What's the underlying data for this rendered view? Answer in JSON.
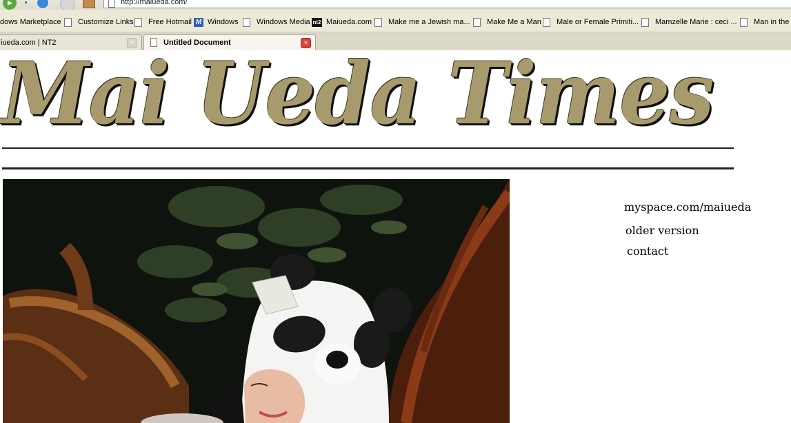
{
  "browser": {
    "address": "http://maiueda.com/",
    "nav_dropdown_glyph": "▾",
    "bookmarks": [
      {
        "label": "dows Marketplace",
        "icon": "none"
      },
      {
        "label": "Customize Links",
        "icon": "page-icon"
      },
      {
        "label": "Free Hotmail",
        "icon": "page-icon"
      },
      {
        "label": "Windows",
        "icon": "msn-m-icon"
      },
      {
        "label": "Windows Media",
        "icon": "page-icon"
      },
      {
        "label": "Maiueda.com",
        "icon": "nt2-icon"
      },
      {
        "label": "Make me a Jewish ma...",
        "icon": "page-icon"
      },
      {
        "label": "Make Me a Man",
        "icon": "page-icon"
      },
      {
        "label": "Male or Female Primiti...",
        "icon": "page-icon"
      },
      {
        "label": "Mamzelle Marie : ceci ...",
        "icon": "page-icon"
      },
      {
        "label": "Man in the I",
        "icon": "page-icon"
      }
    ],
    "tabs": [
      {
        "label": "iueda.com | NT2",
        "active": false
      },
      {
        "label": "Untitled Document",
        "active": true
      }
    ],
    "tab_close_glyph": "×",
    "msn_icon_glyph": "M",
    "nt2_icon_glyph": "nt2"
  },
  "page": {
    "masthead": "Mai Ueda Times",
    "masthead_color": "#a79b6d",
    "links": {
      "myspace": "myspace.com/maiueda",
      "older": "older version",
      "contact": "contact"
    }
  }
}
